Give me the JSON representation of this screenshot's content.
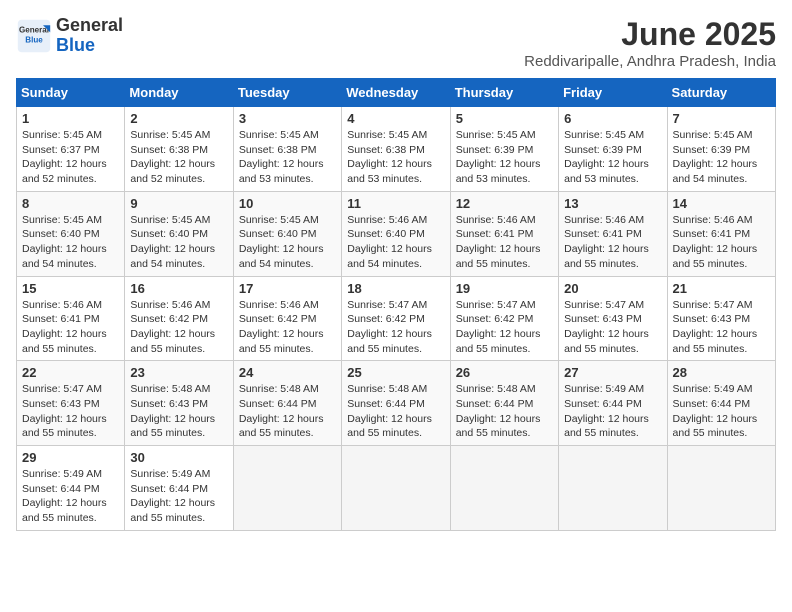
{
  "header": {
    "logo_general": "General",
    "logo_blue": "Blue",
    "month_title": "June 2025",
    "subtitle": "Reddivaripalle, Andhra Pradesh, India"
  },
  "days_of_week": [
    "Sunday",
    "Monday",
    "Tuesday",
    "Wednesday",
    "Thursday",
    "Friday",
    "Saturday"
  ],
  "weeks": [
    [
      {
        "day": 1,
        "sunrise": "5:45 AM",
        "sunset": "6:37 PM",
        "daylight": "12 hours and 52 minutes."
      },
      {
        "day": 2,
        "sunrise": "5:45 AM",
        "sunset": "6:38 PM",
        "daylight": "12 hours and 52 minutes."
      },
      {
        "day": 3,
        "sunrise": "5:45 AM",
        "sunset": "6:38 PM",
        "daylight": "12 hours and 53 minutes."
      },
      {
        "day": 4,
        "sunrise": "5:45 AM",
        "sunset": "6:38 PM",
        "daylight": "12 hours and 53 minutes."
      },
      {
        "day": 5,
        "sunrise": "5:45 AM",
        "sunset": "6:39 PM",
        "daylight": "12 hours and 53 minutes."
      },
      {
        "day": 6,
        "sunrise": "5:45 AM",
        "sunset": "6:39 PM",
        "daylight": "12 hours and 53 minutes."
      },
      {
        "day": 7,
        "sunrise": "5:45 AM",
        "sunset": "6:39 PM",
        "daylight": "12 hours and 54 minutes."
      }
    ],
    [
      {
        "day": 8,
        "sunrise": "5:45 AM",
        "sunset": "6:40 PM",
        "daylight": "12 hours and 54 minutes."
      },
      {
        "day": 9,
        "sunrise": "5:45 AM",
        "sunset": "6:40 PM",
        "daylight": "12 hours and 54 minutes."
      },
      {
        "day": 10,
        "sunrise": "5:45 AM",
        "sunset": "6:40 PM",
        "daylight": "12 hours and 54 minutes."
      },
      {
        "day": 11,
        "sunrise": "5:46 AM",
        "sunset": "6:40 PM",
        "daylight": "12 hours and 54 minutes."
      },
      {
        "day": 12,
        "sunrise": "5:46 AM",
        "sunset": "6:41 PM",
        "daylight": "12 hours and 55 minutes."
      },
      {
        "day": 13,
        "sunrise": "5:46 AM",
        "sunset": "6:41 PM",
        "daylight": "12 hours and 55 minutes."
      },
      {
        "day": 14,
        "sunrise": "5:46 AM",
        "sunset": "6:41 PM",
        "daylight": "12 hours and 55 minutes."
      }
    ],
    [
      {
        "day": 15,
        "sunrise": "5:46 AM",
        "sunset": "6:41 PM",
        "daylight": "12 hours and 55 minutes."
      },
      {
        "day": 16,
        "sunrise": "5:46 AM",
        "sunset": "6:42 PM",
        "daylight": "12 hours and 55 minutes."
      },
      {
        "day": 17,
        "sunrise": "5:46 AM",
        "sunset": "6:42 PM",
        "daylight": "12 hours and 55 minutes."
      },
      {
        "day": 18,
        "sunrise": "5:47 AM",
        "sunset": "6:42 PM",
        "daylight": "12 hours and 55 minutes."
      },
      {
        "day": 19,
        "sunrise": "5:47 AM",
        "sunset": "6:42 PM",
        "daylight": "12 hours and 55 minutes."
      },
      {
        "day": 20,
        "sunrise": "5:47 AM",
        "sunset": "6:43 PM",
        "daylight": "12 hours and 55 minutes."
      },
      {
        "day": 21,
        "sunrise": "5:47 AM",
        "sunset": "6:43 PM",
        "daylight": "12 hours and 55 minutes."
      }
    ],
    [
      {
        "day": 22,
        "sunrise": "5:47 AM",
        "sunset": "6:43 PM",
        "daylight": "12 hours and 55 minutes."
      },
      {
        "day": 23,
        "sunrise": "5:48 AM",
        "sunset": "6:43 PM",
        "daylight": "12 hours and 55 minutes."
      },
      {
        "day": 24,
        "sunrise": "5:48 AM",
        "sunset": "6:44 PM",
        "daylight": "12 hours and 55 minutes."
      },
      {
        "day": 25,
        "sunrise": "5:48 AM",
        "sunset": "6:44 PM",
        "daylight": "12 hours and 55 minutes."
      },
      {
        "day": 26,
        "sunrise": "5:48 AM",
        "sunset": "6:44 PM",
        "daylight": "12 hours and 55 minutes."
      },
      {
        "day": 27,
        "sunrise": "5:49 AM",
        "sunset": "6:44 PM",
        "daylight": "12 hours and 55 minutes."
      },
      {
        "day": 28,
        "sunrise": "5:49 AM",
        "sunset": "6:44 PM",
        "daylight": "12 hours and 55 minutes."
      }
    ],
    [
      {
        "day": 29,
        "sunrise": "5:49 AM",
        "sunset": "6:44 PM",
        "daylight": "12 hours and 55 minutes."
      },
      {
        "day": 30,
        "sunrise": "5:49 AM",
        "sunset": "6:44 PM",
        "daylight": "12 hours and 55 minutes."
      },
      null,
      null,
      null,
      null,
      null
    ]
  ],
  "labels": {
    "sunrise": "Sunrise:",
    "sunset": "Sunset:",
    "daylight": "Daylight:"
  }
}
